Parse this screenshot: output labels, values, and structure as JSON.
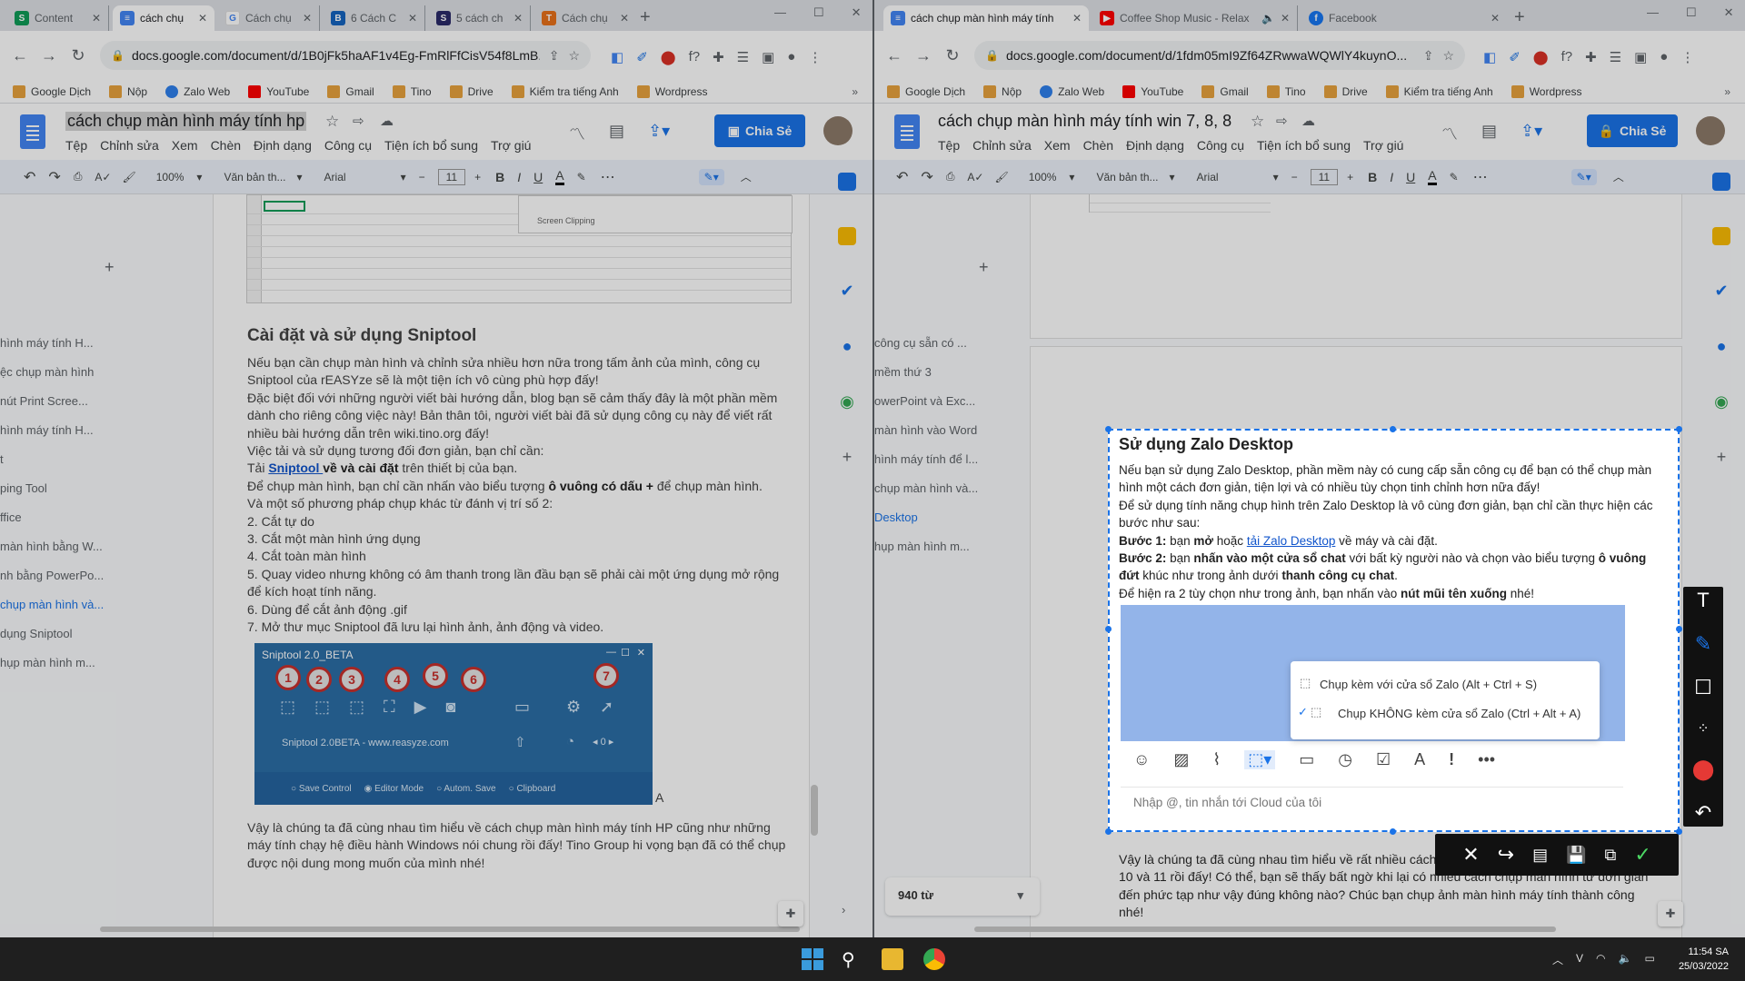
{
  "left": {
    "tabs": [
      {
        "title": "Content",
        "color": "#0f9d58",
        "letter": "S"
      },
      {
        "title": "cách chụ",
        "color": "#4285f4",
        "letter": "D",
        "active": true
      },
      {
        "title": "Cách chụ",
        "color": "#ffffff",
        "letter": "G"
      },
      {
        "title": "6 Cách C",
        "color": "#1565c0",
        "letter": "B"
      },
      {
        "title": "5 cách ch",
        "color": "#2a2a6a",
        "letter": "S"
      },
      {
        "title": "Cách chụ",
        "color": "#e8711a",
        "letter": "T"
      }
    ],
    "url": "docs.google.com/document/d/1B0jFk5haAF1v4Eg-FmRlFfCisV54f8LmB...",
    "doc_title": "cách chụp màn hình máy tính hp",
    "menu": [
      "Tệp",
      "Chỉnh sửa",
      "Xem",
      "Chèn",
      "Định dạng",
      "Công cụ",
      "Tiện ích bổ sung",
      "Trợ giú"
    ],
    "share_label": "Chia Sẻ",
    "zoom": "100%",
    "style": "Văn bản th...",
    "font": "Arial",
    "size": "11",
    "outline": [
      "hình máy tính H...",
      "ệc chụp màn hình",
      "nút Print Scree...",
      "hình máy tính H...",
      "t",
      "ping Tool",
      "ffice",
      "màn hình bằng W...",
      "nh bằng PowerPo...",
      "chụp màn hình và...",
      "dụng Sniptool",
      "hụp màn hình m..."
    ],
    "outline_active": 9,
    "screen_clipping": "Screen Clipping",
    "heading": "Cài đặt và sử dụng Sniptool",
    "p1": "Nếu bạn cần chụp màn hình và chỉnh sửa nhiều hơn nữa trong tấm ảnh của mình, công cụ Sniptool của rEASYze sẽ là một tiện ích vô cùng phù hợp đấy!",
    "p2": "Đặc biệt đối với những người viết bài hướng dẫn, blog bạn sẽ cảm thấy đây là một phần mềm dành cho riêng công việc này! Bản thân tôi, người viết bài đã sử dụng công cụ này để viết rất nhiều bài hướng dẫn trên wiki.tino.org đấy!",
    "p3": "Việc tải và sử dụng tương đối đơn giản, bạn chỉ cần:",
    "p4_pre": "Tải ",
    "p4_link": "Sniptool ",
    "p4_bold": "về và cài đặt",
    "p4_post": " trên thiết bị của bạn.",
    "p5_pre": "Để chụp màn hình, bạn chỉ cần nhấn vào biểu tượng ",
    "p5_bold": "ô vuông có dấu +",
    "p5_post": " để chụp màn hình.",
    "p6": "Và một số phương pháp chụp khác từ đánh vị trí số 2:",
    "list": [
      "2. Cắt tự do",
      "3. Cắt một màn hình ứng dụng",
      "4. Cắt toàn màn hình",
      "5. Quay video nhưng không có âm thanh trong lần đầu bạn sẽ phải cài một ứng dụng mở rộng để kích hoạt tính năng.",
      "6. Dùng để cắt ảnh động .gif",
      "7. Mở thư mục Sniptool đã lưu lại hình ảnh, ảnh động và video."
    ],
    "sniptool_title": "Sniptool 2.0_BETA",
    "sniptool_site": "Sniptool 2.0BETA - www.reasyze.com",
    "sniptool_nums": [
      "1",
      "2",
      "3",
      "4",
      "5",
      "6",
      "7"
    ],
    "sniptool_opts": [
      "Save Control",
      "Editor Mode",
      "Autom. Save",
      "Clipboard"
    ],
    "sniptool_counter": "0",
    "after_img": "A",
    "p7": "Vậy là chúng ta đã cùng nhau tìm hiểu về cách chụp màn hình máy tính HP cũng như những máy tính chạy hệ điều hành Windows nói chung rồi đấy! Tino Group hi vọng bạn đã có thể chụp được nội dung mong muốn của mình nhé!"
  },
  "right": {
    "tabs": [
      {
        "title": "cách chụp màn hình máy tính",
        "color": "#4285f4",
        "letter": "D",
        "active": true
      },
      {
        "title": "Coffee Shop Music - Relax",
        "color": "#ff0000",
        "letter": "▶"
      },
      {
        "title": "Facebook",
        "color": "#1877f2",
        "letter": "f"
      }
    ],
    "url": "docs.google.com/document/d/1fdm05mI9Zf64ZRwwaWQWlY4kuynO...",
    "doc_title": "cách chụp màn hình máy tính win 7, 8, 8",
    "menu": [
      "Tệp",
      "Chỉnh sửa",
      "Xem",
      "Chèn",
      "Định dạng",
      "Công cụ",
      "Tiện ích bổ sung",
      "Trợ giú"
    ],
    "share_label": "Chia Sẻ",
    "zoom": "100%",
    "style": "Văn bản th...",
    "font": "Arial",
    "size": "11",
    "outline": [
      "công cụ sẵn có ...",
      "mềm thứ 3",
      "owerPoint và Exc...",
      "màn hình vào Word",
      "hình máy tính để l...",
      "chụp màn hình và...",
      "Desktop",
      "hụp màn hình m..."
    ],
    "outline_active": 6,
    "heading": "Sử dụng Zalo Desktop",
    "z1": "Nếu bạn sử dụng Zalo Desktop, phần mềm này có cung cấp sẵn công cụ để bạn có thể chụp màn hình một cách đơn giản, tiện lợi và có nhiều tùy chọn tinh chỉnh hơn nữa đấy!",
    "z2": "Để sử dụng tính năng chụp hình trên Zalo Desktop là vô cùng đơn giản, bạn chỉ cần thực hiện các bước như sau:",
    "s1_label": "Bước 1:",
    "s1_a": " bạn ",
    "s1_bold": "mở",
    "s1_b": " hoặc ",
    "s1_link": "tải Zalo Desktop",
    "s1_c": " về máy và cài đặt.",
    "s2_label": "Bước 2:",
    "s2_a": " bạn ",
    "s2_bold1": "nhấn vào một cửa sổ chat",
    "s2_b": " với bất kỳ người nào và chọn vào biểu tượng ",
    "s2_bold2": "ô vuông đứt",
    "s2_c": " khúc như trong ảnh dưới ",
    "s2_bold3": "thanh công cụ chat",
    "s2_d": ".",
    "s3_a": "Để hiện ra 2 tùy chọn như trong ảnh, bạn nhấn vào ",
    "s3_bold": "nút mũi tên xuống",
    "s3_b": " nhé!",
    "zalo_opt1": "Chụp kèm với cửa sổ Zalo (Alt + Ctrl + S)",
    "zalo_opt2": "Chụp KHÔNG kèm cửa sổ Zalo (Ctrl + Alt + A)",
    "zalo_input": "Nhập @, tin nhắn tới Cloud của tôi",
    "end_text": "Vậy là chúng ta đã cùng nhau tìm hiểu về rất nhiều cách chụp màn hình máy tính win 7, 8, 8.1, 10 và 11 rồi đấy! Có thể, bạn sẽ thấy bất ngờ khi lại có nhiều cách chụp màn hình từ đơn giản đến phức tạp như vậy đúng không nào? Chúc bạn chụp ảnh màn hình máy tính thành công nhé!",
    "word_count": "940 từ"
  },
  "bookmarks": [
    "Google Dịch",
    "Nộp",
    "Zalo Web",
    "YouTube",
    "Gmail",
    "Tino",
    "Drive",
    "Kiểm tra tiếng Anh",
    "Wordpress"
  ],
  "clock": {
    "time": "11:54 SA",
    "date": "25/03/2022"
  }
}
